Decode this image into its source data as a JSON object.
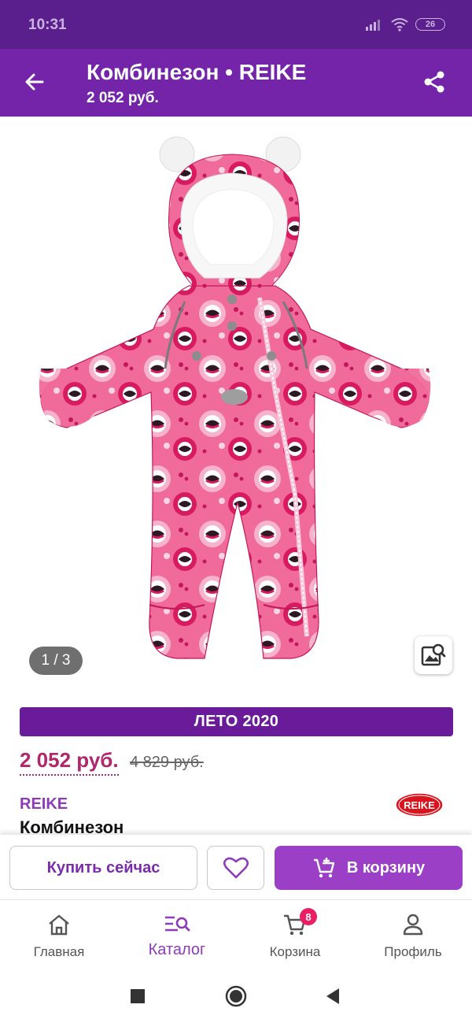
{
  "status_bar": {
    "time": "10:31",
    "battery": "26"
  },
  "app_bar": {
    "title": "Комбинезон • REIKE",
    "subtitle": "2 052 руб."
  },
  "gallery": {
    "page_indicator": "1 / 3"
  },
  "product": {
    "season": "ЛЕТО 2020",
    "price": "2 052 руб.",
    "old_price": "4 829 руб.",
    "brand": "REIKE",
    "brand_logo_text": "REIKE",
    "name": "Комбинезон"
  },
  "actions": {
    "buy_now": "Купить сейчас",
    "add_to_cart": "В корзину"
  },
  "bottom_nav": {
    "items": [
      {
        "label": "Главная",
        "icon": "home-icon"
      },
      {
        "label": "Каталог",
        "icon": "catalog-search-icon"
      },
      {
        "label": "Корзина",
        "icon": "cart-icon",
        "badge": "8"
      },
      {
        "label": "Профиль",
        "icon": "profile-icon"
      }
    ],
    "active": "Каталог"
  },
  "colors": {
    "status_bar": "#5a1f8c",
    "app_bar": "#7324a8",
    "accent": "#9b3fc7",
    "price": "#b0276a",
    "season_badge": "#6a1b9a",
    "badge": "#e91e63"
  }
}
